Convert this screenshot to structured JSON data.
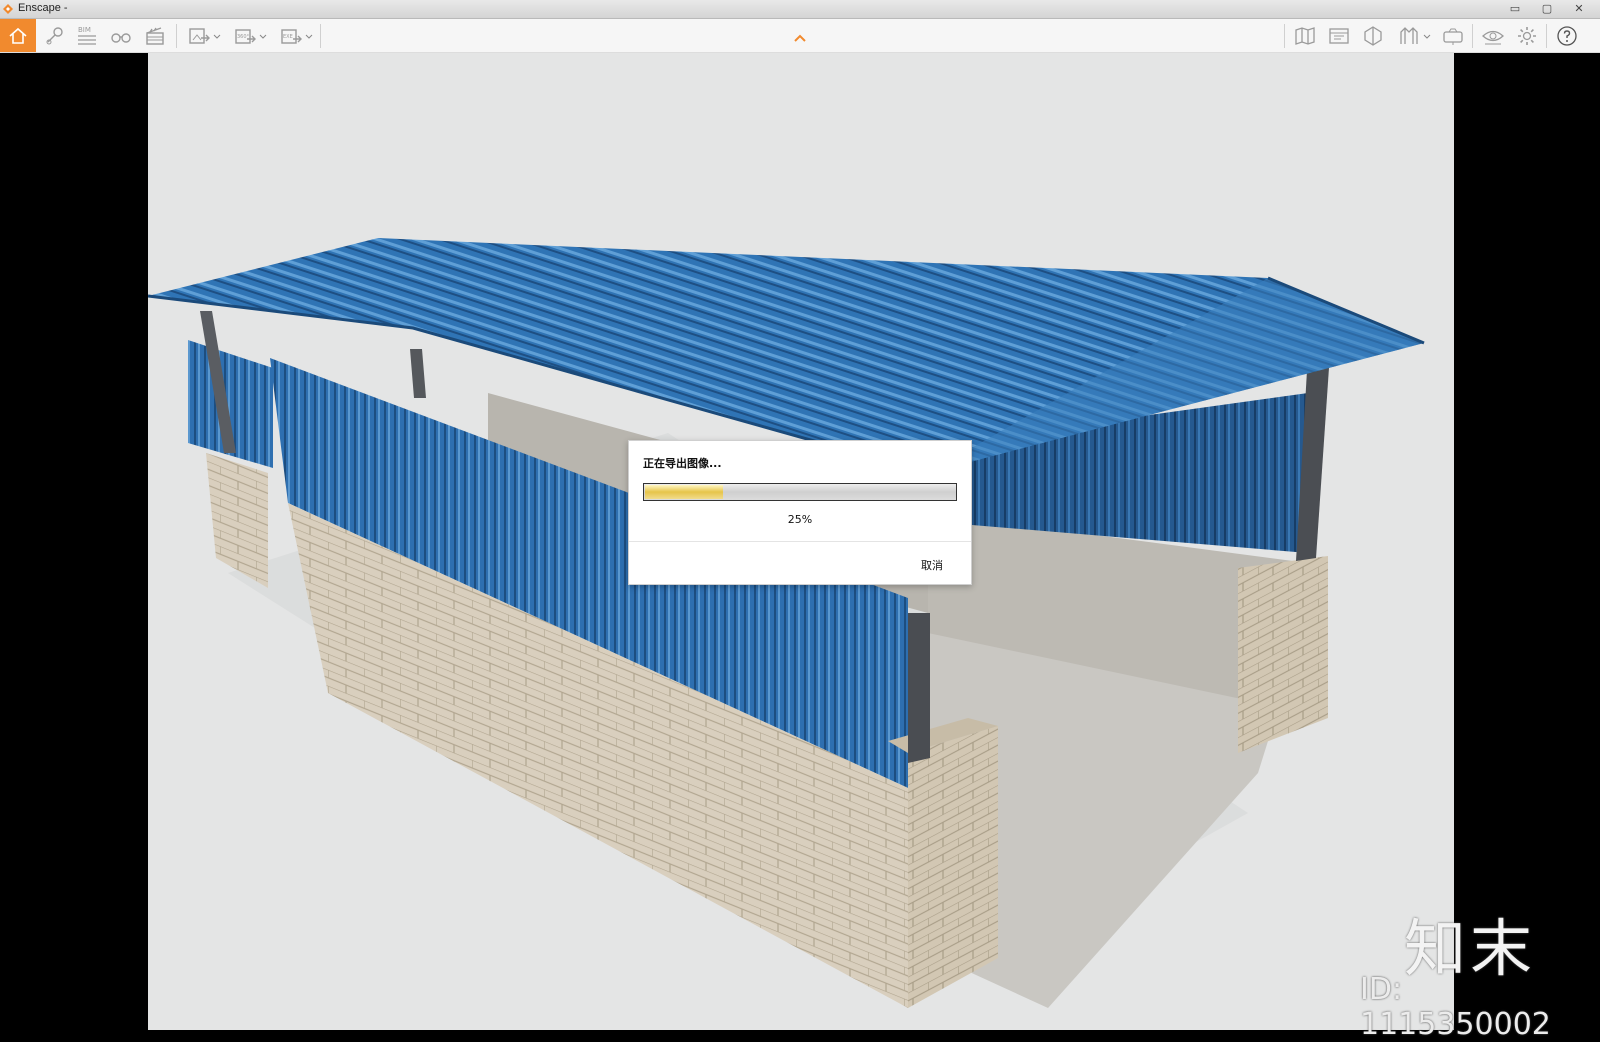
{
  "window": {
    "title": "Enscape -",
    "controls": [
      "▭",
      "▢",
      "✕"
    ]
  },
  "toolbar": {
    "left_icons": [
      "home-icon",
      "pin-icon",
      "bim-icon",
      "binoculars-icon",
      "clapper-icon",
      "export-image-icon",
      "export-panorama-icon",
      "export-exe-icon"
    ],
    "bim_label": "BIM",
    "pano_label": "360°",
    "exe_label": "EXE",
    "right_icons": [
      "map-icon",
      "panel-icon",
      "cube-icon",
      "walk-icon",
      "camera-icon",
      "eye-icon",
      "gear-icon",
      "help-icon"
    ],
    "collapse_icon": "chevron-up-icon"
  },
  "dialog": {
    "title": "正在导出图像...",
    "progress": 0.25,
    "percent_text": "25%",
    "cancel_label": "取消"
  },
  "watermark": {
    "logo_text": "知末",
    "id_text": "ID: 1115350002"
  },
  "colors": {
    "accent": "#f18a2e",
    "roof": "#2f74b5",
    "wall_blue": "#2e6fb0",
    "brick": "#d7cdbc",
    "concrete": "#c9c7c2"
  }
}
